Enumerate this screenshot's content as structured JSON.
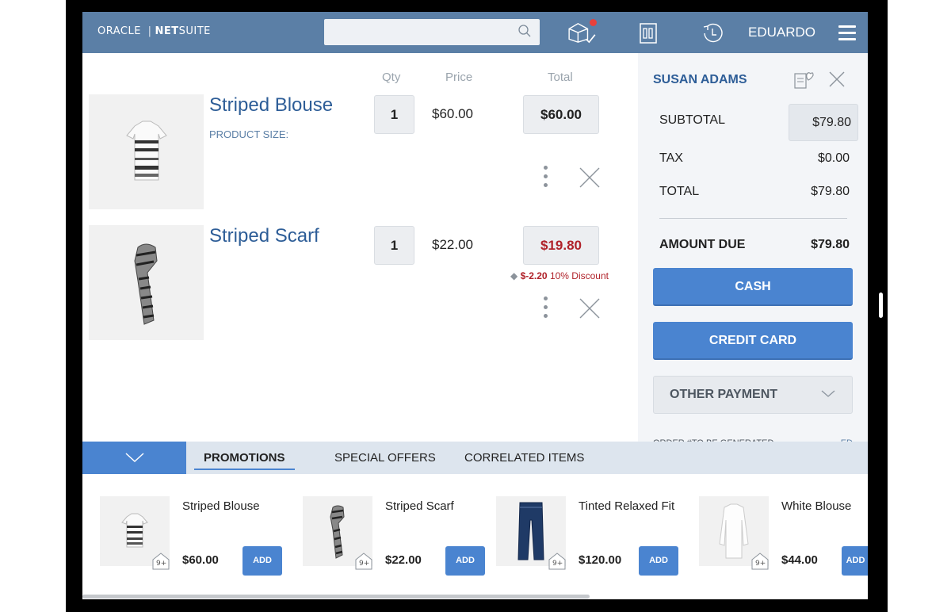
{
  "header": {
    "logo_oracle": "ORACLE",
    "logo_sep": "|",
    "logo_net": "NET",
    "logo_suite": "SUITE",
    "search_placeholder": "",
    "user": "EDUARDO"
  },
  "cart": {
    "col_qty": "Qty",
    "col_price": "Price",
    "col_total": "Total",
    "items": [
      {
        "name": "Striped Blouse",
        "size_label": "PRODUCT SIZE:",
        "qty": "1",
        "price": "$60.00",
        "total": "$60.00"
      },
      {
        "name": "Striped Scarf",
        "qty": "1",
        "price": "$22.00",
        "total": "$19.80",
        "discount_amount": "$-2.20",
        "discount_text": "10% Discount"
      }
    ]
  },
  "summary": {
    "customer": "SUSAN ADAMS",
    "subtotal_label": "SUBTOTAL",
    "subtotal": "$79.80",
    "tax_label": "TAX",
    "tax": "$0.00",
    "total_label": "TOTAL",
    "total": "$79.80",
    "due_label": "AMOUNT DUE",
    "due": "$79.80",
    "cash": "CASH",
    "credit": "CREDIT CARD",
    "other": "OTHER PAYMENT",
    "order_note": "ORDER #TO BE GENERATED",
    "order_note_right": "ED"
  },
  "tabs": {
    "promotions": "PROMOTIONS",
    "special": "SPECIAL OFFERS",
    "correlated": "CORRELATED ITEMS"
  },
  "promos": [
    {
      "title": "Striped Blouse",
      "price": "$60.00",
      "badge": "9+",
      "add": "ADD"
    },
    {
      "title": "Striped Scarf",
      "price": "$22.00",
      "badge": "9+",
      "add": "ADD"
    },
    {
      "title": "Tinted Relaxed Fit",
      "price": "$120.00",
      "badge": "9+",
      "add": "ADD"
    },
    {
      "title": "White Blouse",
      "price": "$44.00",
      "badge": "9+",
      "add": "ADD"
    }
  ],
  "colors": {
    "accent": "#4a84d0",
    "header": "#5b7fa6",
    "discount": "#b0222a"
  }
}
